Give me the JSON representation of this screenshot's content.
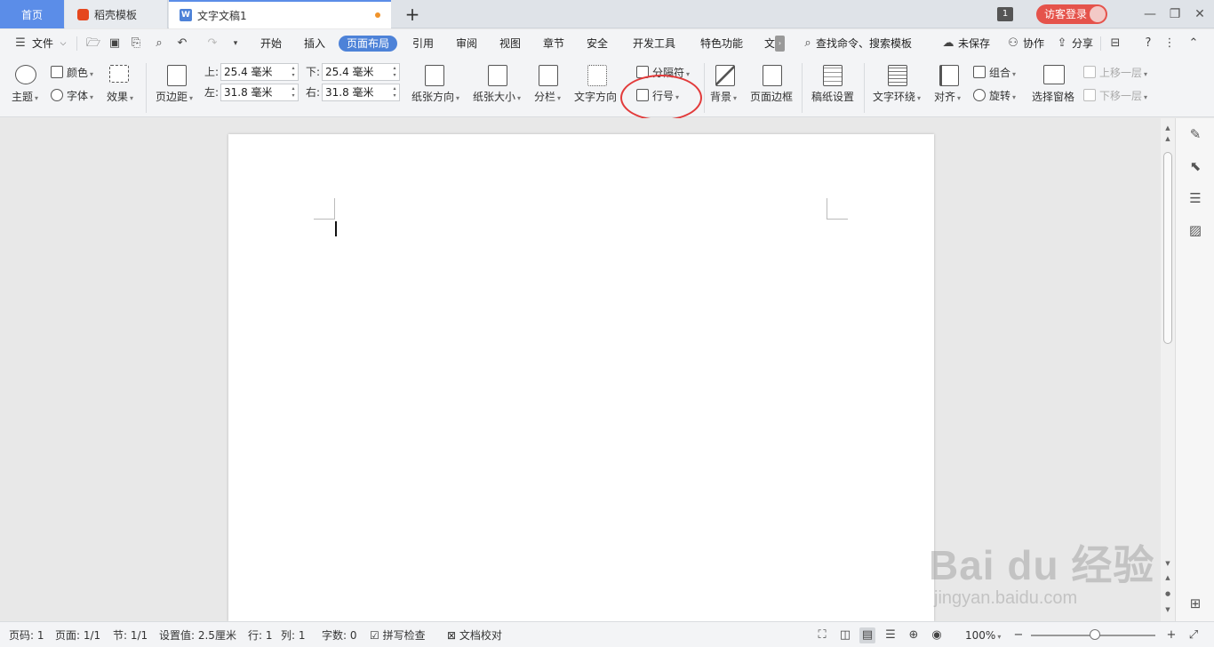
{
  "tabs": {
    "home": "首页",
    "template": "稻壳模板",
    "doc": "文字文稿1",
    "doc_icon_letter": "W",
    "add": "+"
  },
  "titlebar": {
    "counter": "1",
    "login": "访客登录",
    "minimize": "—",
    "restore": "❐",
    "close": "✕"
  },
  "menu": {
    "file": "文件",
    "items": [
      "开始",
      "插入",
      "页面布局",
      "引用",
      "审阅",
      "视图",
      "章节",
      "安全",
      "开发工具",
      "特色功能",
      "文"
    ],
    "active": "页面布局",
    "search": "查找命令、搜索模板",
    "unsaved": "未保存",
    "collab": "协作",
    "share": "分享"
  },
  "ribbon": {
    "theme": "主题",
    "color": "颜色",
    "font": "字体",
    "effect": "效果",
    "margin": "页边距",
    "margin_top_label": "上:",
    "margin_top": "25.4 毫米",
    "margin_bottom_label": "下:",
    "margin_bottom": "25.4 毫米",
    "margin_left_label": "左:",
    "margin_left": "31.8 毫米",
    "margin_right_label": "右:",
    "margin_right": "31.8 毫米",
    "orientation": "纸张方向",
    "size": "纸张大小",
    "columns": "分栏",
    "text_direction": "文字方向",
    "separator": "分隔符",
    "line_number": "行号",
    "background": "背景",
    "page_border": "页面边框",
    "manuscript": "稿纸设置",
    "wrap": "文字环绕",
    "align": "对齐",
    "group": "组合",
    "rotate": "旋转",
    "selection_pane": "选择窗格",
    "bring_forward": "上移一层",
    "send_backward": "下移一层"
  },
  "status": {
    "page": "页码: 1",
    "pages": "页面: 1/1",
    "section": "节: 1/1",
    "setting": "设置值: 2.5厘米",
    "row": "行: 1",
    "col": "列: 1",
    "words": "字数: 0",
    "spell": "拼写检查",
    "proof": "文档校对",
    "zoom": "100%"
  },
  "watermark": {
    "brand": "Bai du 经验",
    "url": "jingyan.baidu.com"
  },
  "colors": {
    "accent": "#4d82d8",
    "home_tab": "#5b8de8",
    "login": "#e5534b",
    "highlight": "#e23b3b"
  }
}
